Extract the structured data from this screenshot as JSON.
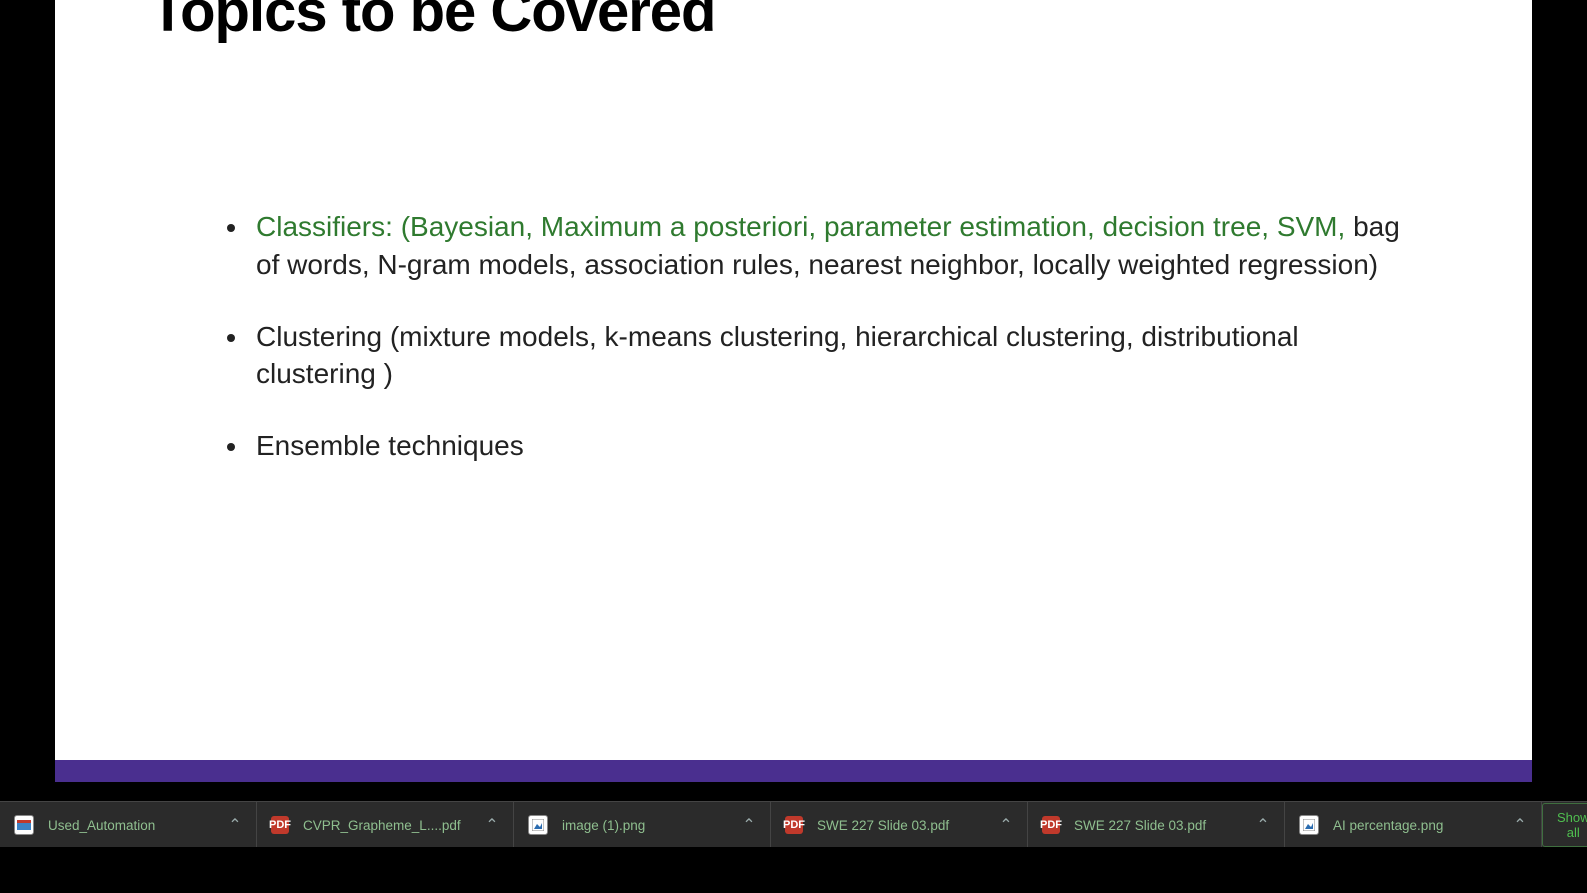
{
  "slide": {
    "title": "Topics to be Covered",
    "bullet1_green": "Classifiers: (Bayesian, Maximum a posteriori, parameter estimation, decision tree, SVM, ",
    "bullet1_rest": "bag of words, N-gram models, association rules, nearest neighbor, locally weighted regression)",
    "bullet2": "Clustering (mixture models, k-means clustering, hierarchical clustering, distributional clustering )",
    "bullet3": "Ensemble techniques"
  },
  "downloads": {
    "items": [
      {
        "label": "Used_Automation"
      },
      {
        "label": "CVPR_Grapheme_L....pdf"
      },
      {
        "label": "image (1).png"
      },
      {
        "label": "SWE 227 Slide 03.pdf"
      },
      {
        "label": "SWE 227 Slide 03.pdf"
      },
      {
        "label": "AI percentage.png"
      }
    ],
    "show_all": "Show all"
  }
}
